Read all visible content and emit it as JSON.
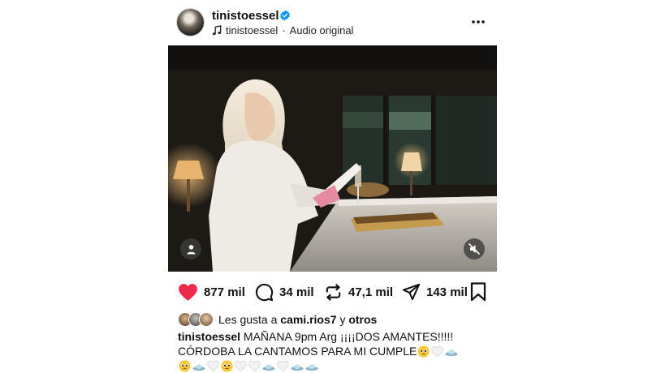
{
  "header": {
    "username": "tinistoessel",
    "audio_artist": "tinistoessel",
    "audio_separator": "·",
    "audio_label": "Audio original"
  },
  "actions": {
    "likes_count": "877 mil",
    "comments_count": "34 mil",
    "reposts_count": "47,1 mil",
    "shares_count": "143 mil"
  },
  "likes": {
    "prefix": "Les gusta a",
    "user": "cami.rios7",
    "joiner": "y",
    "others": "otros"
  },
  "caption": {
    "username": "tinistoessel",
    "line1": "MAÑANA 9pm Arg ¡¡¡¡DOS AMANTES!!!!!",
    "line2": "CÓRDOBA LA CANTAMOS PARA MI CUMPLE"
  },
  "colors": {
    "like_red": "#ed2a4b",
    "verified_blue": "#0095f6",
    "text": "#111111"
  },
  "icons": {
    "like": "heart-icon",
    "comment": "comment-icon",
    "repost": "repost-icon",
    "share": "share-icon",
    "save": "bookmark-icon",
    "audio": "music-note-icon",
    "more": "more-dots-icon",
    "tag": "user-tag-icon",
    "mute": "speaker-muted-icon"
  }
}
